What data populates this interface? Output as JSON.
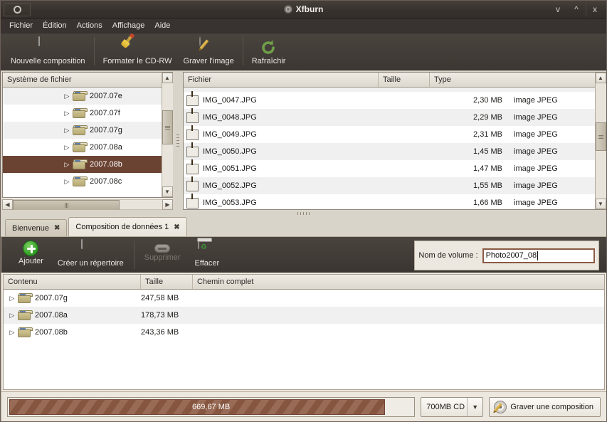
{
  "window": {
    "title": "Xfburn",
    "title_icon": "cd-disc-icon",
    "menu_icon": "window-menu-icon",
    "controls": {
      "minimize": "v",
      "maximize": "^",
      "close": "x"
    }
  },
  "menubar": [
    {
      "label": "Fichier",
      "mnemonic": "F"
    },
    {
      "label": "Édition",
      "mnemonic": "É"
    },
    {
      "label": "Actions",
      "mnemonic": "A"
    },
    {
      "label": "Affichage",
      "mnemonic": "A"
    },
    {
      "label": "Aide",
      "mnemonic": "A"
    }
  ],
  "toolbar": {
    "buttons": [
      {
        "label": "Nouvelle composition",
        "icon": "new-composition-icon"
      },
      {
        "label": "Formater le CD-RW",
        "icon": "format-cdrw-icon"
      },
      {
        "label": "Graver l'image",
        "icon": "burn-image-icon"
      },
      {
        "label": "Rafraîchir",
        "icon": "refresh-icon"
      }
    ]
  },
  "filesystem_tree": {
    "header": "Système de fichier",
    "rows": [
      {
        "name": "2007.07e",
        "selected": false
      },
      {
        "name": "2007.07f",
        "selected": false
      },
      {
        "name": "2007.07g",
        "selected": false
      },
      {
        "name": "2007.08a",
        "selected": false
      },
      {
        "name": "2007.08b",
        "selected": true
      },
      {
        "name": "2007.08c",
        "selected": false
      }
    ]
  },
  "file_list": {
    "columns": [
      "Fichier",
      "Taille",
      "Type"
    ],
    "rows": [
      {
        "name": "IMG_0047.JPG",
        "size": "2,30 MB",
        "type": "image JPEG"
      },
      {
        "name": "IMG_0048.JPG",
        "size": "2,29 MB",
        "type": "image JPEG"
      },
      {
        "name": "IMG_0049.JPG",
        "size": "2,31 MB",
        "type": "image JPEG"
      },
      {
        "name": "IMG_0050.JPG",
        "size": "1,45 MB",
        "type": "image JPEG"
      },
      {
        "name": "IMG_0051.JPG",
        "size": "1,47 MB",
        "type": "image JPEG"
      },
      {
        "name": "IMG_0052.JPG",
        "size": "1,55 MB",
        "type": "image JPEG"
      },
      {
        "name": "IMG_0053.JPG",
        "size": "1,66 MB",
        "type": "image JPEG"
      }
    ]
  },
  "tabs": [
    {
      "label": "Bienvenue",
      "active": false,
      "close": "✖"
    },
    {
      "label": "Composition de données 1",
      "active": true,
      "close": "✖"
    }
  ],
  "composition_toolbar": {
    "buttons": [
      {
        "label": "Ajouter",
        "icon": "add-icon",
        "disabled": false
      },
      {
        "label": "Créer un répertoire",
        "icon": "new-directory-icon",
        "disabled": false
      },
      {
        "label": "Supprimer",
        "icon": "remove-icon",
        "disabled": true
      },
      {
        "label": "Effacer",
        "icon": "clear-trash-icon",
        "disabled": false
      }
    ],
    "volume_label": "Nom de volume :",
    "volume_value": "Photo2007_08"
  },
  "composition_list": {
    "columns": [
      "Contenu",
      "Taille",
      "Chemin complet"
    ],
    "rows": [
      {
        "name": "2007.07g",
        "size": "247,58 MB",
        "path": ""
      },
      {
        "name": "2007.08a",
        "size": "178,73 MB",
        "path": ""
      },
      {
        "name": "2007.08b",
        "size": "243,36 MB",
        "path": ""
      }
    ]
  },
  "statusbar": {
    "progress_text": "669,67 MB",
    "progress_percent": 93,
    "disc_size": "700MB CD",
    "burn_button": "Graver une composition",
    "burn_icon": "burn-composition-icon"
  },
  "colors": {
    "selection": "#6b4332",
    "progress_fill": "#8d5a43",
    "focus_border": "#8a5a43",
    "toolbar_bg": "#423c37"
  }
}
